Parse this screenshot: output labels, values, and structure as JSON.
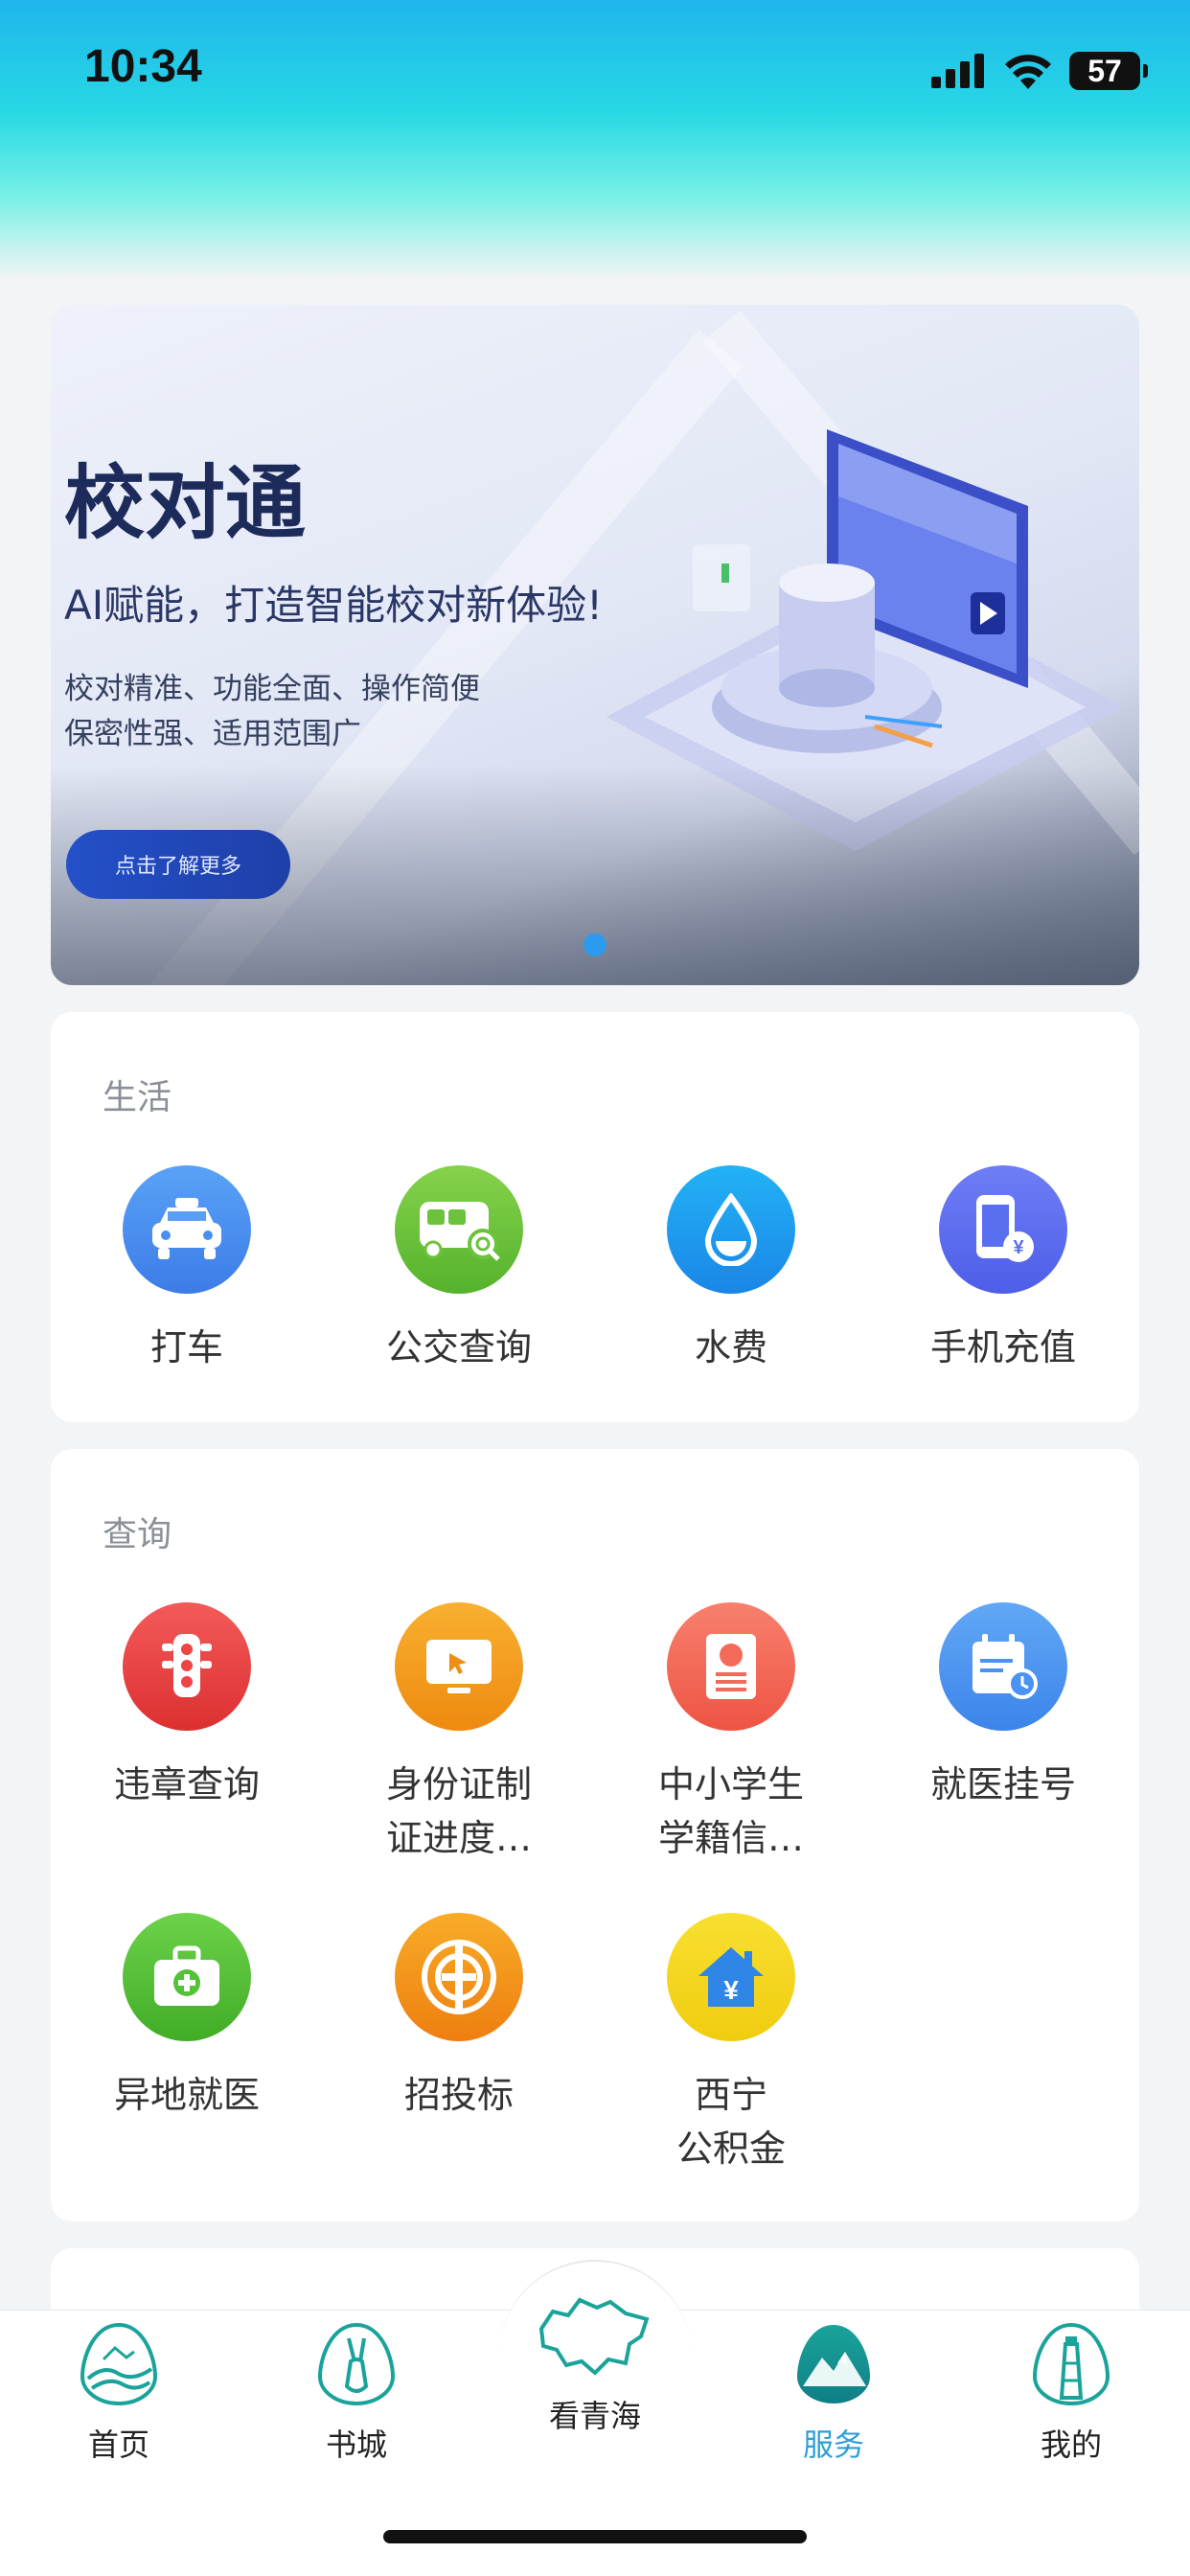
{
  "status_bar": {
    "time": "10:34",
    "battery": "57"
  },
  "banner": {
    "title": "校对通",
    "subtitle": "AI赋能，打造智能校对新体验!",
    "desc_line1": "校对精准、功能全面、操作简便",
    "desc_line2": "保密性强、适用范围广",
    "button_label": "点击了解更多"
  },
  "life_section": {
    "title": "生活",
    "items": [
      {
        "label": "打车",
        "icon": "taxi-icon",
        "color": "#4a8ff0"
      },
      {
        "label": "公交查询",
        "icon": "bus-icon",
        "color": "#6dc23c"
      },
      {
        "label": "水费",
        "icon": "water-drop-icon",
        "color": "#1a9ff0"
      },
      {
        "label": "手机充值",
        "icon": "phone-recharge-icon",
        "color": "#5a6ef0"
      }
    ]
  },
  "query_section": {
    "title": "查询",
    "items": [
      {
        "label": "违章查询",
        "icon": "traffic-light-icon",
        "color": "#ee4444"
      },
      {
        "label_line1": "身份证制",
        "label_line2": "证进度…",
        "icon": "monitor-icon",
        "color": "#f5a020"
      },
      {
        "label_line1": "中小学生",
        "label_line2": "学籍信…",
        "icon": "student-card-icon",
        "color": "#f46a5a"
      },
      {
        "label": "就医挂号",
        "icon": "calendar-icon",
        "color": "#4a93f2"
      },
      {
        "label": "异地就医",
        "icon": "medical-kit-icon",
        "color": "#52c236"
      },
      {
        "label": "招投标",
        "icon": "bid-icon",
        "color": "#f59a20"
      },
      {
        "label_line1": "西宁",
        "label_line2": "公积金",
        "icon": "housing-fund-icon",
        "color": "#f5d820"
      }
    ]
  },
  "bottom_nav": {
    "items": [
      {
        "label": "首页",
        "icon": "home-mountain-icon"
      },
      {
        "label": "书城",
        "icon": "antelope-icon"
      },
      {
        "label": "看青海",
        "icon": "qinghai-map-icon"
      },
      {
        "label": "服务",
        "icon": "service-mountain-icon",
        "active": true
      },
      {
        "label": "我的",
        "icon": "tower-icon"
      }
    ],
    "active_color": "#2a9fd6"
  }
}
